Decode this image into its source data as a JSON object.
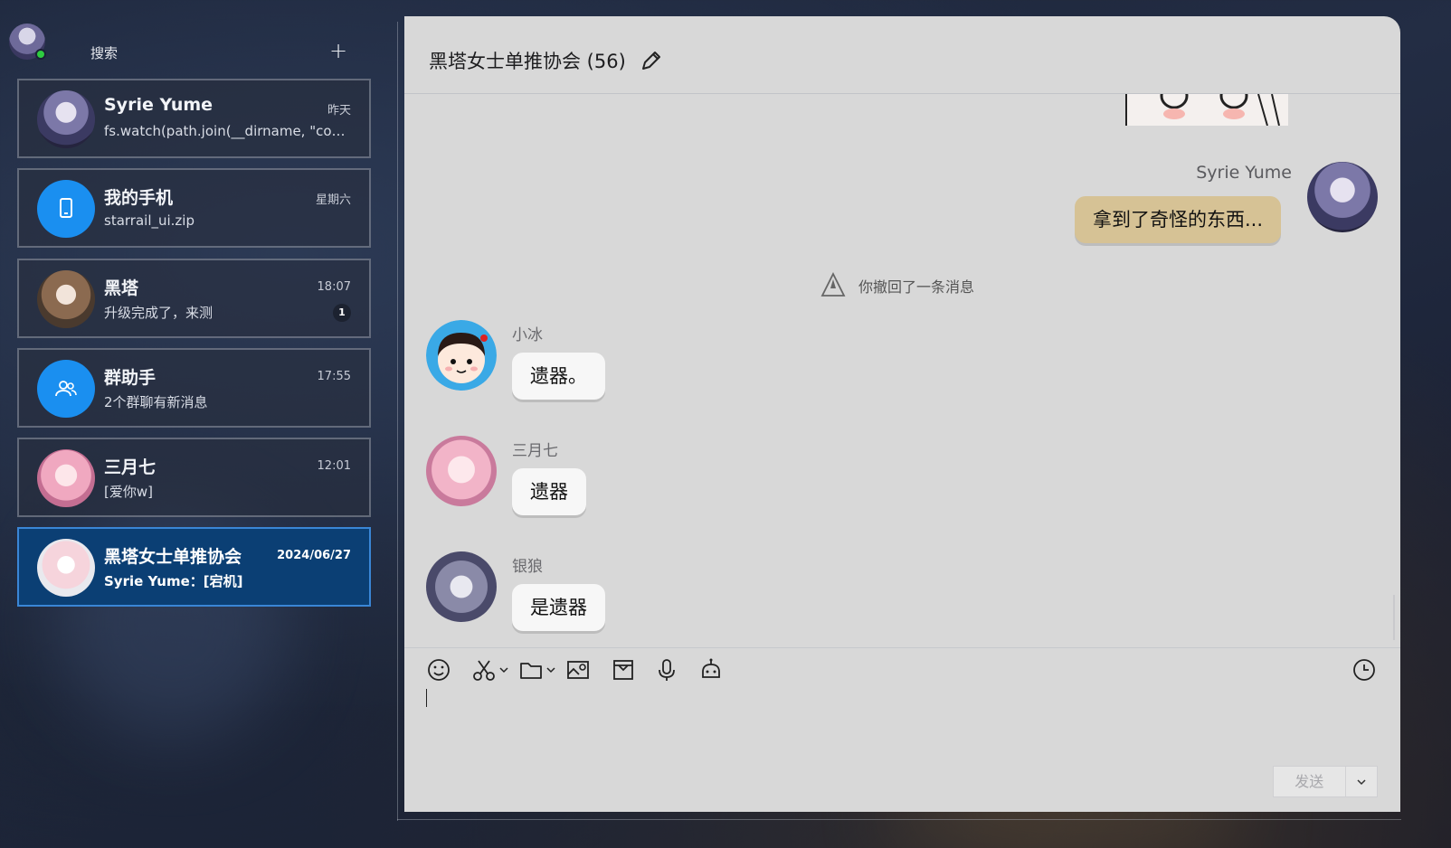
{
  "sidebar": {
    "search_label": "搜索",
    "add_symbol": "+",
    "conversations": [
      {
        "name": "Syrie Yume",
        "time": "昨天",
        "preview": "fs.watch(path.join(__dirname, \"conf...",
        "badge": ""
      },
      {
        "name": "我的手机",
        "time": "星期六",
        "preview": "starrail_ui.zip",
        "badge": ""
      },
      {
        "name": "黑塔",
        "time": "18:07",
        "preview": "升级完成了，来测",
        "badge": "1"
      },
      {
        "name": "群助手",
        "time": "17:55",
        "preview": "2个群聊有新消息",
        "badge": ""
      },
      {
        "name": "三月七",
        "time": "12:01",
        "preview": "[爱你w]",
        "badge": ""
      },
      {
        "name": "黑塔女士单推协会",
        "time": "2024/06/27",
        "preview": "Syrie Yume：[宕机]",
        "badge": ""
      }
    ]
  },
  "chat": {
    "title": "黑塔女士单推协会 (56)",
    "messages": {
      "mine_sender": "Syrie Yume",
      "mine_text": "拿到了奇怪的东西...",
      "system": "你撤回了一条消息",
      "xiaobing_sender": "小冰",
      "xiaobing_text": "遗器。",
      "march_sender": "三月七",
      "march_text": "遗器",
      "wolf_sender": "银狼",
      "wolf_text": "是遗器"
    },
    "send_label": "发送"
  },
  "colors": {
    "active_conv": "#0b3f74",
    "accent_blue": "#1a8ff0",
    "my_bubble": "#d6c295",
    "online": "#2ecc40"
  },
  "icons": [
    "emoji-icon",
    "scissors-icon",
    "folder-icon",
    "image-icon",
    "mailbox-icon",
    "microphone-icon",
    "robot-icon",
    "history-clock-icon",
    "edit-pencil-icon",
    "phone-icon",
    "group-icon",
    "recall-icon",
    "chevron-down-icon"
  ]
}
